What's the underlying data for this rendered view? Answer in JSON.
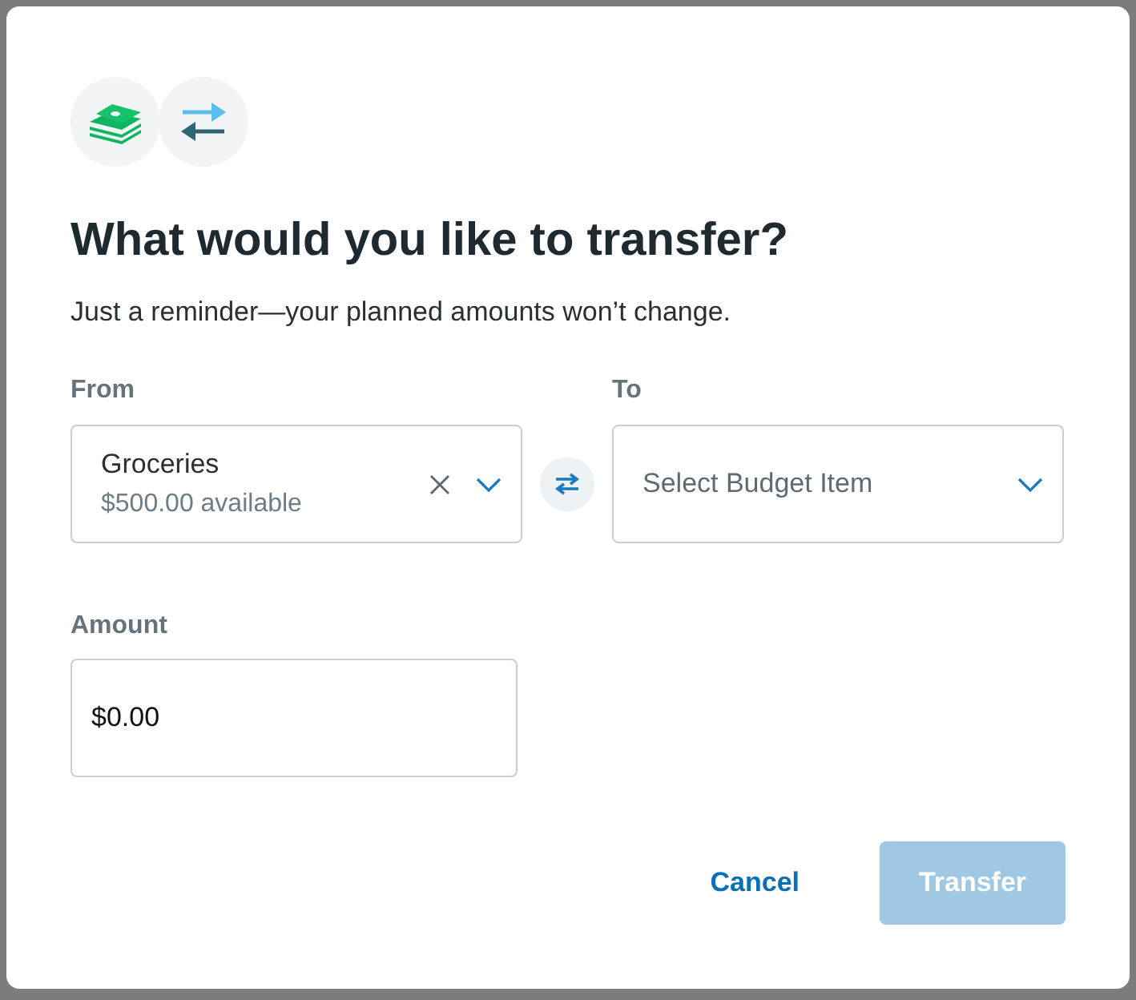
{
  "dialog": {
    "title": "What would you like to transfer?",
    "subtitle": "Just a reminder—your planned amounts won’t change.",
    "from": {
      "label": "From",
      "value": "Groceries",
      "detail": "$500.00 available",
      "clearable": true
    },
    "to": {
      "label": "To",
      "placeholder": "Select Budget Item"
    },
    "amount": {
      "label": "Amount",
      "value": "$0.00"
    },
    "buttons": [
      {
        "kind": "link",
        "label": "Cancel",
        "disabled": false
      },
      {
        "kind": "primary",
        "label": "Transfer",
        "disabled": true
      }
    ]
  }
}
